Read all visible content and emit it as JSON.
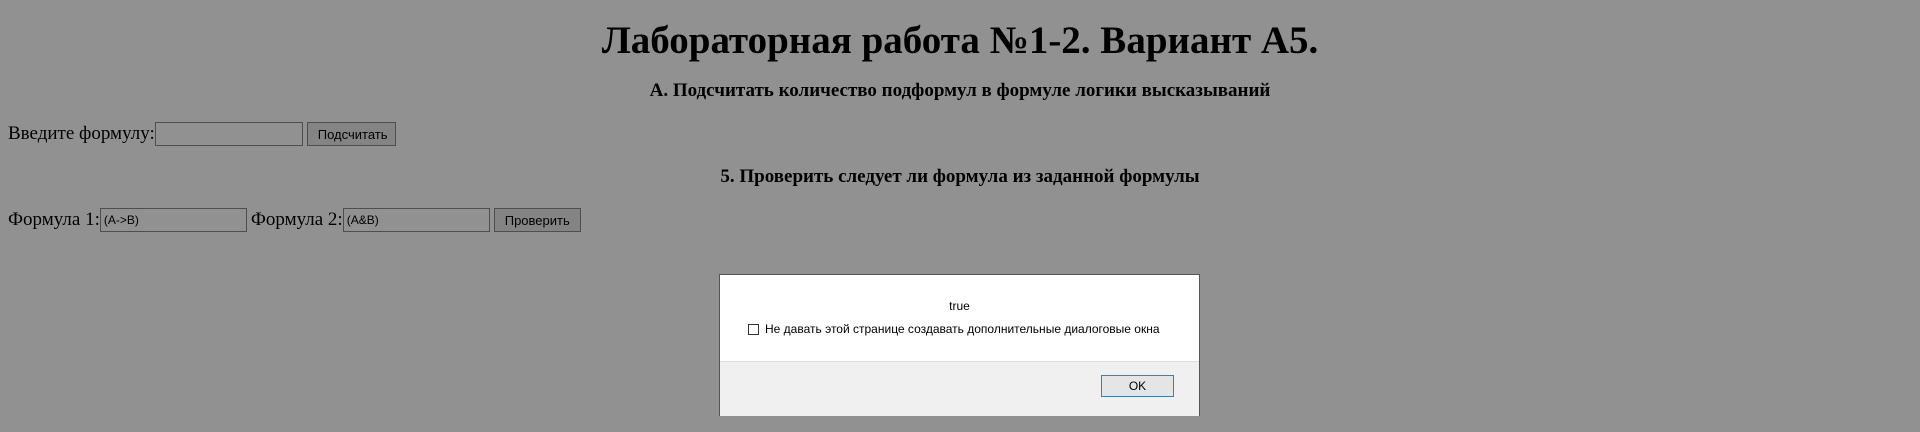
{
  "page": {
    "title": "Лабораторная работа №1-2. Вариант А5.",
    "section_a": {
      "heading": "А. Подсчитать количество подформул в формуле логики высказываний",
      "input_label": "Введите формулу:",
      "input_value": "",
      "button_label": "Подсчитать"
    },
    "section_5": {
      "heading": "5. Проверить следует ли формула из заданной формулы",
      "formula1_label": "Формула 1:",
      "formula1_value": "(A->B)",
      "formula2_label": "Формула 2:",
      "formula2_value": "(A&B)",
      "button_label": "Проверить"
    }
  },
  "dialog": {
    "message": "true",
    "checkbox_label": "Не давать этой странице создавать дополнительные диалоговые окна",
    "checkbox_checked": false,
    "ok_label": "OK"
  }
}
